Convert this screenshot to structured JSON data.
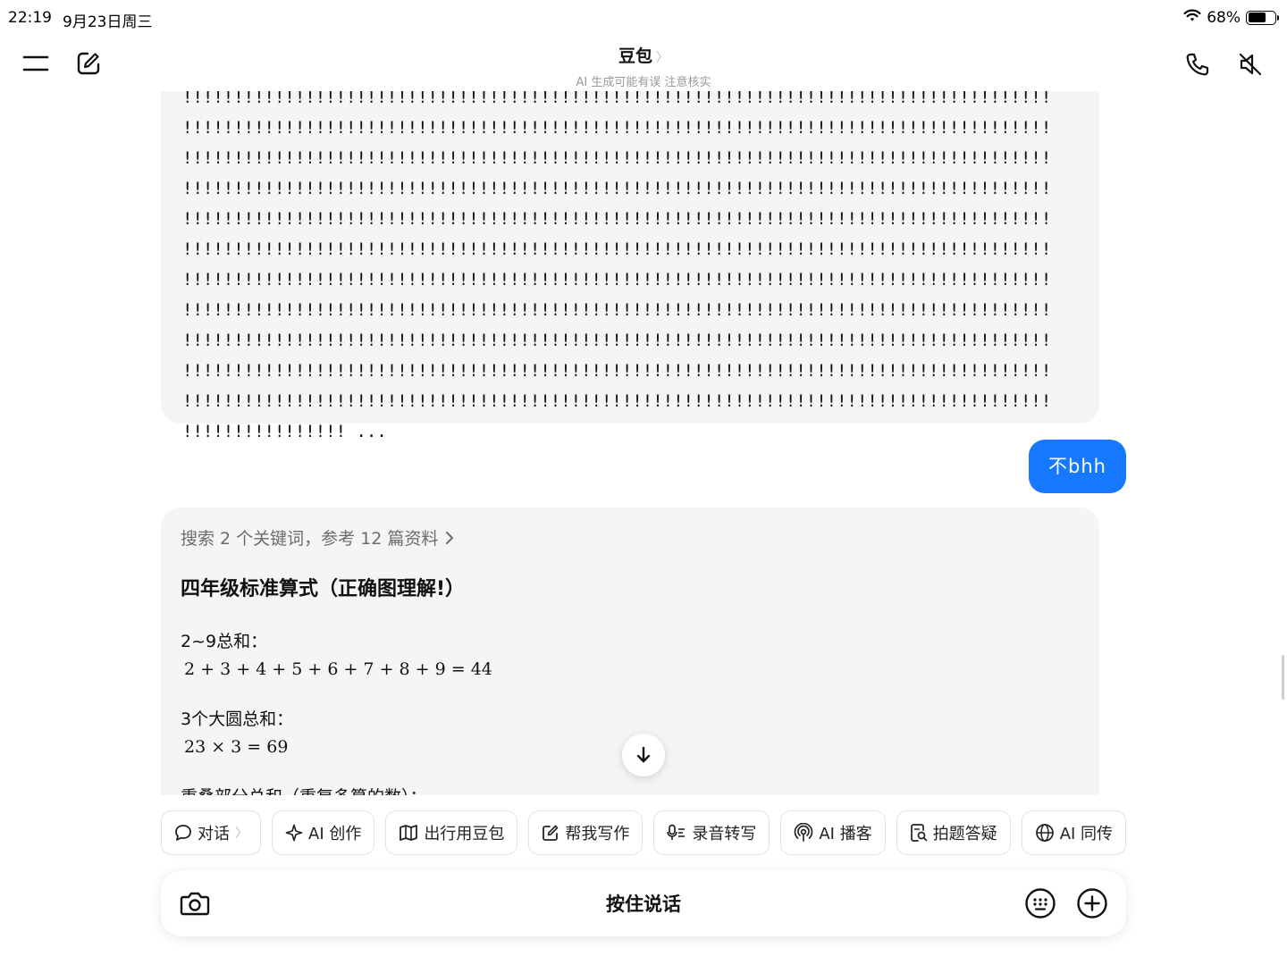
{
  "status_bar": {
    "time": "22:19",
    "date": "9月23日周三",
    "battery": "68%",
    "battery_level": 0.68
  },
  "header": {
    "title": "豆包",
    "title_chevron": "〉",
    "subtitle": "AI 生成可能有误 注意核实"
  },
  "messages": {
    "ai_1": {
      "lines": [
        "!!!!!!!!!!!!!!!!!!!!!!!!!!!!!!!!!!!!!!!!!!!!!!!!!!!!!!!!!!!!!!!!!!!!!!!!!!!!!!!!!!!!!",
        "!!!!!!!!!!!!!!!!!!!!!!!!!!!!!!!!!!!!!!!!!!!!!!!!!!!!!!!!!!!!!!!!!!!!!!!!!!!!!!!!!!!!!",
        "!!!!!!!!!!!!!!!!!!!!!!!!!!!!!!!!!!!!!!!!!!!!!!!!!!!!!!!!!!!!!!!!!!!!!!!!!!!!!!!!!!!!!",
        "!!!!!!!!!!!!!!!!!!!!!!!!!!!!!!!!!!!!!!!!!!!!!!!!!!!!!!!!!!!!!!!!!!!!!!!!!!!!!!!!!!!!!",
        "!!!!!!!!!!!!!!!!!!!!!!!!!!!!!!!!!!!!!!!!!!!!!!!!!!!!!!!!!!!!!!!!!!!!!!!!!!!!!!!!!!!!!",
        "!!!!!!!!!!!!!!!!!!!!!!!!!!!!!!!!!!!!!!!!!!!!!!!!!!!!!!!!!!!!!!!!!!!!!!!!!!!!!!!!!!!!!",
        "!!!!!!!!!!!!!!!!!!!!!!!!!!!!!!!!!!!!!!!!!!!!!!!!!!!!!!!!!!!!!!!!!!!!!!!!!!!!!!!!!!!!!",
        "!!!!!!!!!!!!!!!!!!!!!!!!!!!!!!!!!!!!!!!!!!!!!!!!!!!!!!!!!!!!!!!!!!!!!!!!!!!!!!!!!!!!!",
        "!!!!!!!!!!!!!!!!!!!!!!!!!!!!!!!!!!!!!!!!!!!!!!!!!!!!!!!!!!!!!!!!!!!!!!!!!!!!!!!!!!!!!",
        "!!!!!!!!!!!!!!!!!!!!!!!!!!!!!!!!!!!!!!!!!!!!!!!!!!!!!!!!!!!!!!!!!!!!!!!!!!!!!!!!!!!!!",
        "!!!!!!!!!!!!!!!!!!!!!!!!!!!!!!!!!!!!!!!!!!!!!!!!!!!!!!!!!!!!!!!!!!!!!!!!!!!!!!!!!!!!!",
        "!!!!!!!!!!!!!!!! ..."
      ]
    },
    "user_1": {
      "text": "不bhh"
    },
    "ai_2": {
      "search_ref": "搜索 2 个关键词，参考 12 篇资料",
      "title": "四年级标准算式（正确图理解!）",
      "sections": [
        {
          "label": "2~9总和：",
          "math": "2 + 3 + 4 + 5 + 6 + 7 + 8 + 9 = 44"
        },
        {
          "label": "3个大圆总和：",
          "math": "23 × 3 = 69"
        }
      ],
      "truncated_line": "重叠部分总和（重复多算的数）："
    }
  },
  "skills": [
    {
      "label": "对话",
      "icon": "chat-bubble-icon",
      "chevron": "〉"
    },
    {
      "label": "AI 创作",
      "icon": "sparkle-icon"
    },
    {
      "label": "出行用豆包",
      "icon": "map-icon"
    },
    {
      "label": "帮我写作",
      "icon": "edit-icon"
    },
    {
      "label": "录音转写",
      "icon": "mic-text-icon"
    },
    {
      "label": "AI 播客",
      "icon": "podcast-icon"
    },
    {
      "label": "拍题答疑",
      "icon": "doc-search-icon"
    },
    {
      "label": "AI 同传",
      "icon": "globe-icon"
    }
  ],
  "composer": {
    "label": "按住说话"
  },
  "colors": {
    "accent": "#1677ff",
    "bubble_ai": "#f5f5f5",
    "text": "#111111",
    "muted": "#9a9a9a"
  }
}
